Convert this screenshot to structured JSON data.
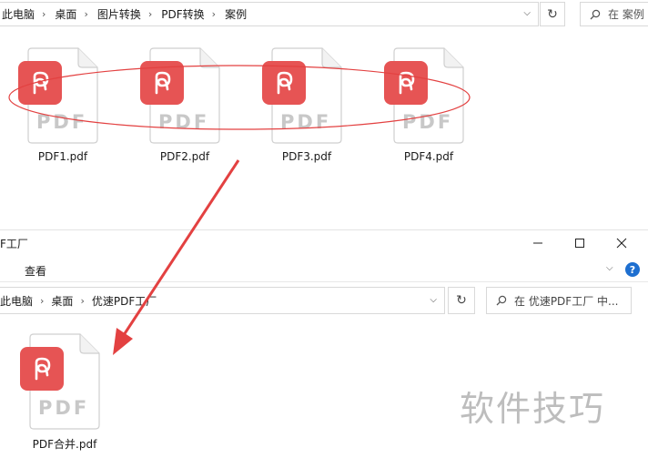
{
  "top_window": {
    "breadcrumb": [
      "此电脑",
      "桌面",
      "图片转换",
      "PDF转换",
      "案例"
    ],
    "search_placeholder": "在 案例",
    "files": [
      {
        "name": "PDF1.pdf",
        "badge_text": "PDF"
      },
      {
        "name": "PDF2.pdf",
        "badge_text": "PDF"
      },
      {
        "name": "PDF3.pdf",
        "badge_text": "PDF"
      },
      {
        "name": "PDF4.pdf",
        "badge_text": "PDF"
      }
    ]
  },
  "bottom_window": {
    "title": "F工厂",
    "menu_view": "查看",
    "breadcrumb": [
      "此电脑",
      "桌面",
      "优速PDF工厂"
    ],
    "search_placeholder": "在 优速PDF工厂 中...",
    "file": {
      "name": "PDF合并.pdf",
      "badge_text": "PDF"
    },
    "help_label": "?"
  },
  "watermark": "软件技巧",
  "colors": {
    "badge": "#e65454",
    "annotation": "#e34141",
    "pdf_text": "#c8c8c8"
  },
  "icons": {
    "search": "search-icon",
    "refresh": "refresh-icon",
    "chevron": "chevron-down-icon",
    "minimize": "minimize-icon",
    "maximize": "maximize-icon",
    "close": "close-icon",
    "help": "help-icon"
  }
}
